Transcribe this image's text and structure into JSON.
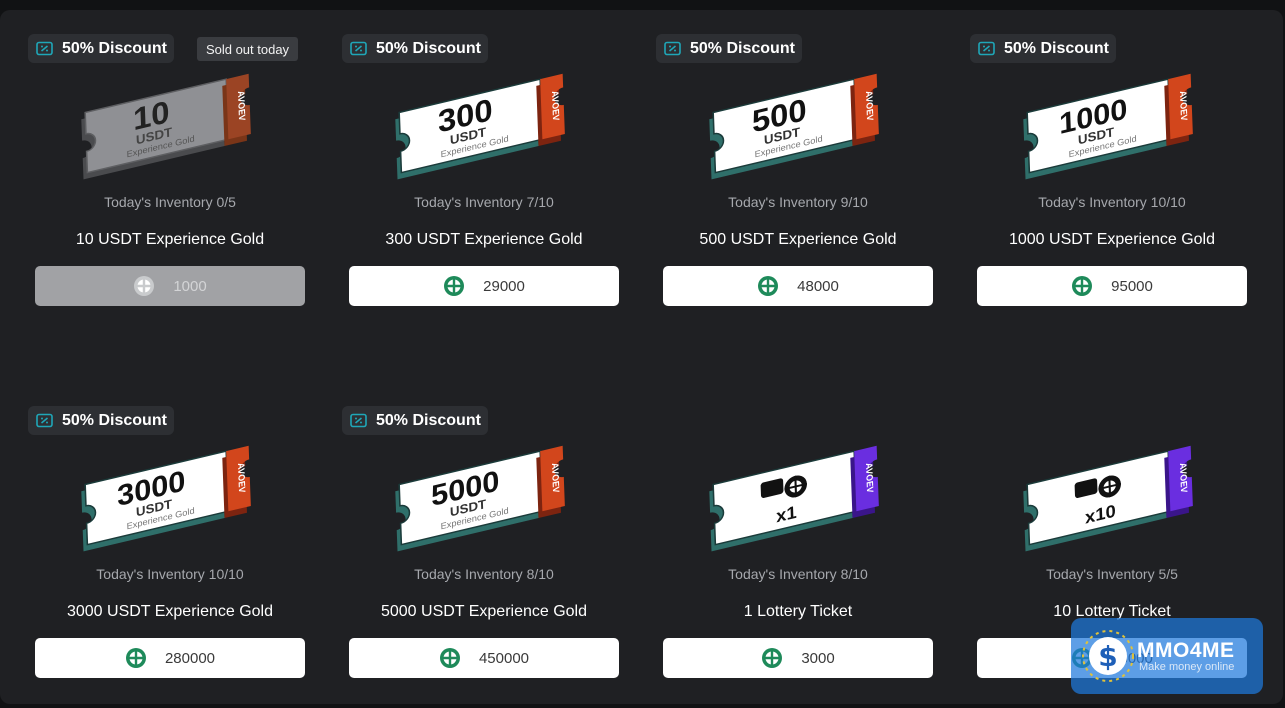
{
  "colors": {
    "page_bg": "#111214",
    "panel_bg": "#1f2023",
    "usdt_stub": "#c9431b",
    "lottery_stub": "#6a2ee0",
    "coin_green": "#1e8a5a",
    "badge_icon": "#1fa7b8"
  },
  "cards": [
    {
      "discount": "50% Discount",
      "sold_out": "Sold out today",
      "ticket_amount": "10",
      "ticket_unit": "USDT",
      "ticket_sub": "Experience Gold",
      "stub_brand": "AVOEV",
      "inventory": "Today's Inventory 0/5",
      "title": "10 USDT Experience Gold",
      "price": "1000",
      "disabled": true
    },
    {
      "discount": "50% Discount",
      "ticket_amount": "300",
      "ticket_unit": "USDT",
      "ticket_sub": "Experience Gold",
      "stub_brand": "AVOEV",
      "inventory": "Today's Inventory 7/10",
      "title": "300 USDT Experience Gold",
      "price": "29000"
    },
    {
      "discount": "50% Discount",
      "ticket_amount": "500",
      "ticket_unit": "USDT",
      "ticket_sub": "Experience Gold",
      "stub_brand": "AVOEV",
      "inventory": "Today's Inventory 9/10",
      "title": "500 USDT Experience Gold",
      "price": "48000"
    },
    {
      "discount": "50% Discount",
      "ticket_amount": "1000",
      "ticket_unit": "USDT",
      "ticket_sub": "Experience Gold",
      "stub_brand": "AVOEV",
      "inventory": "Today's Inventory 10/10",
      "title": "1000 USDT Experience Gold",
      "price": "95000"
    },
    {
      "discount": "50% Discount",
      "ticket_amount": "3000",
      "ticket_unit": "USDT",
      "ticket_sub": "Experience Gold",
      "stub_brand": "AVOEV",
      "inventory": "Today's Inventory 10/10",
      "title": "3000 USDT Experience Gold",
      "price": "280000"
    },
    {
      "discount": "50% Discount",
      "ticket_amount": "5000",
      "ticket_unit": "USDT",
      "ticket_sub": "Experience Gold",
      "stub_brand": "AVOEV",
      "inventory": "Today's Inventory 8/10",
      "title": "5000 USDT Experience Gold",
      "price": "450000"
    },
    {
      "ticket_qty": "x1",
      "stub_brand": "AVOEV",
      "inventory": "Today's Inventory 8/10",
      "title": "1 Lottery Ticket",
      "price": "3000"
    },
    {
      "ticket_qty": "x10",
      "stub_brand": "AVOEV",
      "inventory": "Today's Inventory 5/5",
      "title": "10 Lottery Ticket",
      "price": "28000"
    }
  ],
  "watermark": {
    "title": "MMO4ME",
    "subtitle": "Make money online"
  }
}
